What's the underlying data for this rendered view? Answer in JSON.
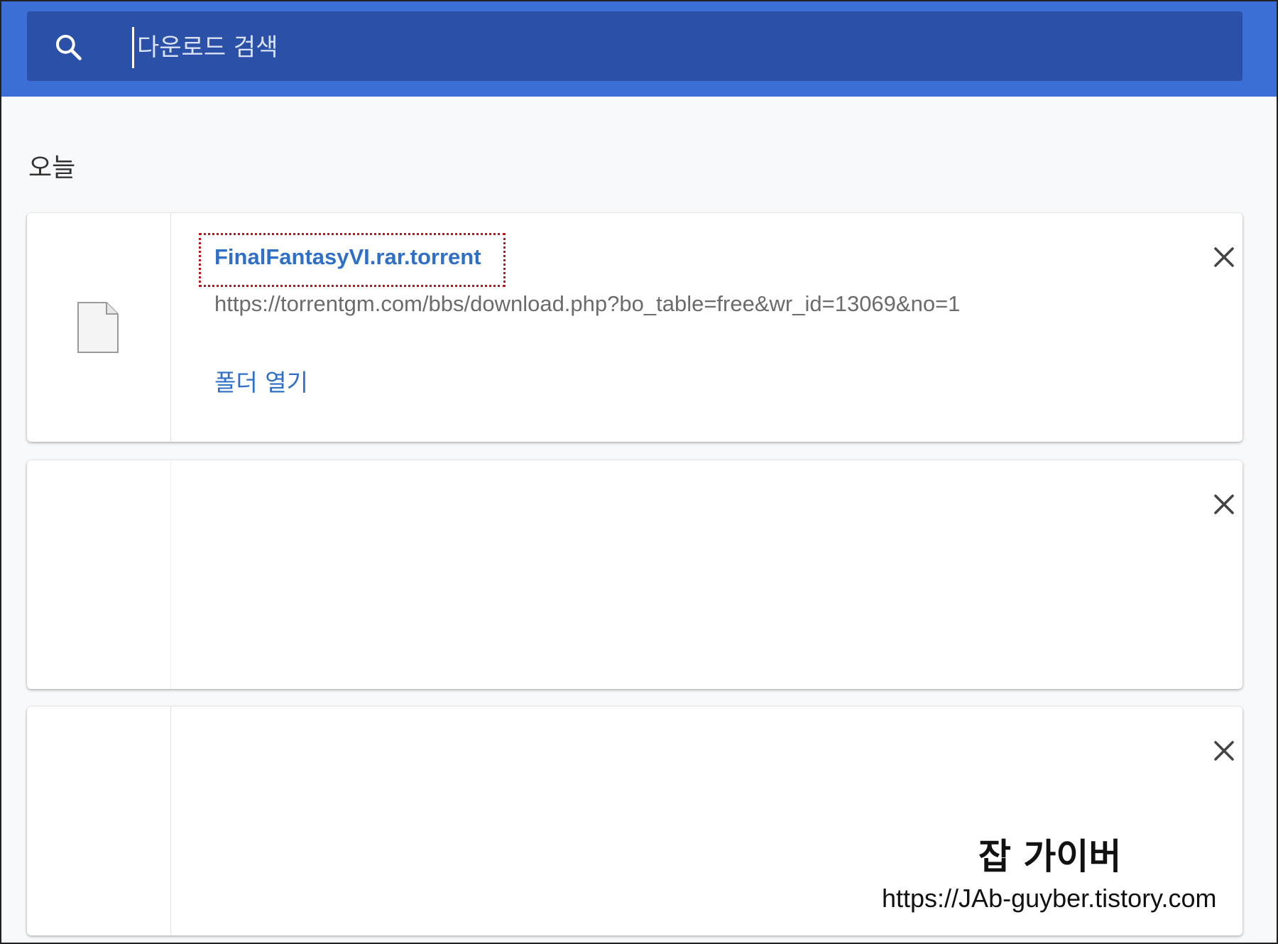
{
  "search": {
    "placeholder": "다운로드 검색"
  },
  "section": {
    "title": "오늘"
  },
  "downloads": [
    {
      "file_name": "FinalFantasyVI.rar.torrent",
      "url": "https://torrentgm.com/bbs/download.php?bo_table=free&wr_id=13069&no=1",
      "action_label": "폴더 열기"
    },
    {},
    {}
  ],
  "watermark": {
    "title": "잡 가이버",
    "url": "https://JAb-guyber.tistory.com"
  },
  "colors": {
    "header": "#3b6fd6",
    "search_bar": "#2a50a8",
    "link": "#2f6fc8",
    "highlight": "#c0161b"
  },
  "icons": {
    "search": "search-icon",
    "file": "file-icon",
    "close": "close-icon"
  }
}
